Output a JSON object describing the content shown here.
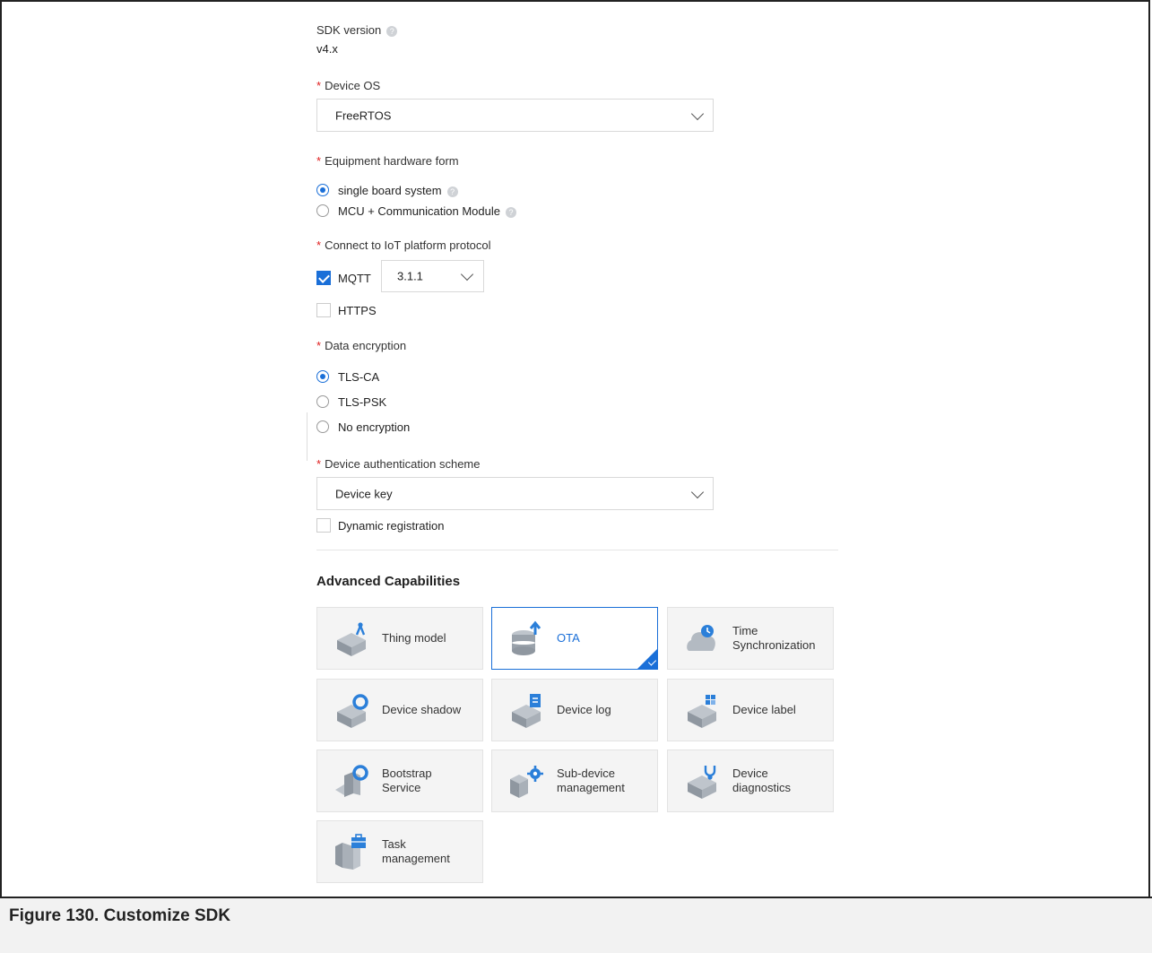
{
  "sdk": {
    "label": "SDK version",
    "help": "?",
    "value": "v4.x"
  },
  "device_os": {
    "label": "Device OS",
    "value": "FreeRTOS"
  },
  "hardware_form": {
    "label": "Equipment hardware form",
    "options": [
      {
        "label": "single board system",
        "selected": true
      },
      {
        "label": "MCU + Communication Module",
        "selected": false
      }
    ]
  },
  "protocol": {
    "label": "Connect to IoT platform protocol",
    "mqtt": {
      "label": "MQTT",
      "checked": true,
      "version": "3.1.1"
    },
    "https": {
      "label": "HTTPS",
      "checked": false
    }
  },
  "encryption": {
    "label": "Data encryption",
    "options": [
      {
        "label": "TLS-CA",
        "selected": true
      },
      {
        "label": "TLS-PSK",
        "selected": false
      },
      {
        "label": "No encryption",
        "selected": false
      }
    ]
  },
  "auth": {
    "label": "Device authentication scheme",
    "value": "Device key",
    "dynamic": {
      "label": "Dynamic registration",
      "checked": false
    }
  },
  "advanced": {
    "title": "Advanced Capabilities",
    "cards": [
      {
        "name": "Thing model",
        "icon": "thing-model-icon",
        "selected": false
      },
      {
        "name": "OTA",
        "icon": "ota-icon",
        "selected": true
      },
      {
        "name": "Time Synchronization",
        "icon": "time-sync-icon",
        "selected": false
      },
      {
        "name": "Device shadow",
        "icon": "device-shadow-icon",
        "selected": false
      },
      {
        "name": "Device log",
        "icon": "device-log-icon",
        "selected": false
      },
      {
        "name": "Device label",
        "icon": "device-label-icon",
        "selected": false
      },
      {
        "name": "Bootstrap Service",
        "icon": "bootstrap-icon",
        "selected": false
      },
      {
        "name": "Sub-device management",
        "icon": "sub-device-icon",
        "selected": false
      },
      {
        "name": "Device diagnostics",
        "icon": "diagnostics-icon",
        "selected": false
      },
      {
        "name": "Task management",
        "icon": "task-management-icon",
        "selected": false
      }
    ]
  },
  "caption": "Figure 130. Customize SDK",
  "colors": {
    "accent": "#1a6fd8",
    "required": "#e02020"
  }
}
